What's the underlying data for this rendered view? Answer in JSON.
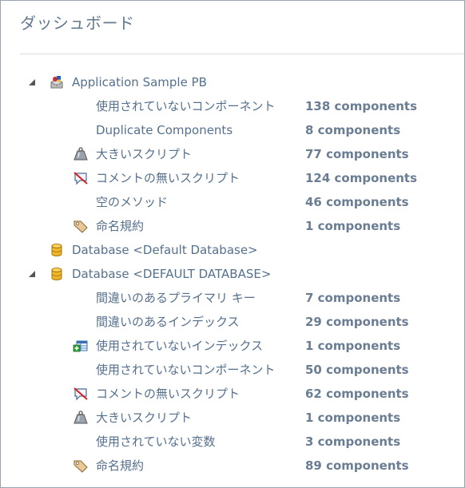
{
  "header": {
    "title": "ダッシュボード"
  },
  "tree": {
    "app": {
      "label": "Application Sample PB",
      "items": [
        {
          "label": "使用されていないコンポーネント",
          "count": "138 components"
        },
        {
          "label": "Duplicate Components",
          "count": "8 components"
        },
        {
          "label": "大きいスクリプト",
          "count": "77 components",
          "icon": "weight-icon"
        },
        {
          "label": "コメントの無いスクリプト",
          "count": "124 components",
          "icon": "no-comment-icon"
        },
        {
          "label": "空のメソッド",
          "count": "46 components"
        },
        {
          "label": "命名規約",
          "count": "1 components",
          "icon": "tag-icon"
        }
      ]
    },
    "db1": {
      "label": "Database <Default Database>"
    },
    "db2": {
      "label": "Database <DEFAULT DATABASE>",
      "items": [
        {
          "label": "間違いのあるプライマリ キー",
          "count": "7 components"
        },
        {
          "label": "間違いのあるインデックス",
          "count": "29 components"
        },
        {
          "label": "使用されていないインデックス",
          "count": "1 components",
          "icon": "table-add-icon"
        },
        {
          "label": "使用されていないコンポーネント",
          "count": "50 components"
        },
        {
          "label": "コメントの無いスクリプト",
          "count": "62 components",
          "icon": "no-comment-icon"
        },
        {
          "label": "大きいスクリプト",
          "count": "1 components",
          "icon": "weight-icon"
        },
        {
          "label": "使用されていない変数",
          "count": "3 components"
        },
        {
          "label": "命名規約",
          "count": "89 components",
          "icon": "tag-icon"
        }
      ]
    }
  },
  "colors": {
    "text": "#55708d",
    "count": "#6a7d92",
    "title": "#637990",
    "db": "#e5a80f"
  }
}
